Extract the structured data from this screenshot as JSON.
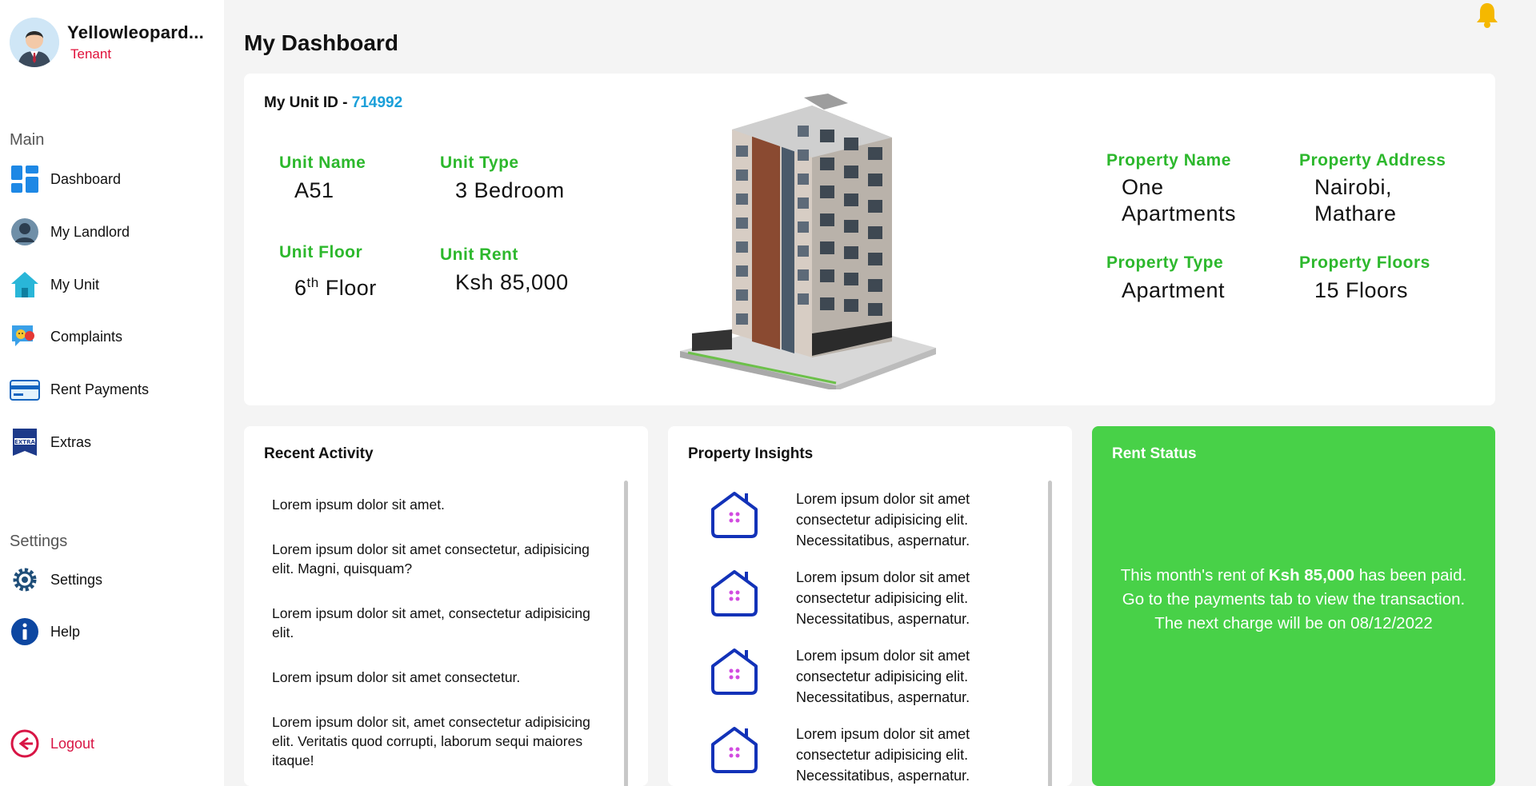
{
  "user": {
    "name": "Yellowleopard...",
    "role": "Tenant"
  },
  "sidebar": {
    "main_title": "Main",
    "items": [
      {
        "label": "Dashboard",
        "icon": "dashboard-icon"
      },
      {
        "label": "My Landlord",
        "icon": "landlord-icon"
      },
      {
        "label": "My Unit",
        "icon": "home-icon"
      },
      {
        "label": "Complaints",
        "icon": "complaints-icon"
      },
      {
        "label": "Rent Payments",
        "icon": "credit-card-icon"
      },
      {
        "label": "Extras",
        "icon": "extras-icon"
      }
    ],
    "settings_title": "Settings",
    "settings_items": [
      {
        "label": "Settings",
        "icon": "gear-icon"
      },
      {
        "label": "Help",
        "icon": "info-icon"
      }
    ],
    "logout_label": "Logout"
  },
  "header": {
    "title": "My Dashboard",
    "notification_icon": "bell-icon"
  },
  "unit": {
    "id_label": "My Unit ID -",
    "id_value": "714992",
    "name_label": "Unit Name",
    "name_value": "A51",
    "type_label": "Unit Type",
    "type_value": "3 Bedroom",
    "floor_label": "Unit Floor",
    "floor_number": "6",
    "floor_suffix": "th",
    "floor_word": "Floor",
    "rent_label": "Unit Rent",
    "rent_value": "Ksh 85,000"
  },
  "property": {
    "name_label": "Property Name",
    "name_line1": "One",
    "name_line2": "Apartments",
    "address_label": "Property Address",
    "address_line1": "Nairobi,",
    "address_line2": "Mathare",
    "type_label": "Property Type",
    "type_value": "Apartment",
    "floors_label": "Property Floors",
    "floors_value": "15 Floors"
  },
  "recent_activity": {
    "title": "Recent Activity",
    "items": [
      "Lorem ipsum dolor sit amet.",
      "Lorem ipsum dolor sit amet consectetur, adipisicing elit. Magni, quisquam?",
      "Lorem ipsum dolor sit amet, consectetur adipisicing elit.",
      "Lorem ipsum dolor sit amet consectetur.",
      "Lorem ipsum dolor sit, amet consectetur adipisicing elit. Veritatis quod corrupti, laborum sequi maiores itaque!"
    ]
  },
  "insights": {
    "title": "Property Insights",
    "items": [
      "Lorem ipsum dolor sit amet consectetur adipisicing elit. Necessitatibus, aspernatur.",
      "Lorem ipsum dolor sit amet consectetur adipisicing elit. Necessitatibus, aspernatur.",
      "Lorem ipsum dolor sit amet consectetur adipisicing elit. Necessitatibus, aspernatur.",
      "Lorem ipsum dolor sit amet consectetur adipisicing elit. Necessitatibus, aspernatur."
    ]
  },
  "rent_status": {
    "title": "Rent Status",
    "line1_prefix": "This month's rent of",
    "amount": "Ksh 85,000",
    "line1_suffix": "has been paid.",
    "line2": "Go to the payments tab to view the transaction.",
    "line3": "The next charge will be on 08/12/2022"
  },
  "colors": {
    "accent_green": "#2db82d",
    "rent_card_green": "#48d148",
    "link_blue": "#1a9fd9",
    "danger_red": "#e0103a"
  }
}
